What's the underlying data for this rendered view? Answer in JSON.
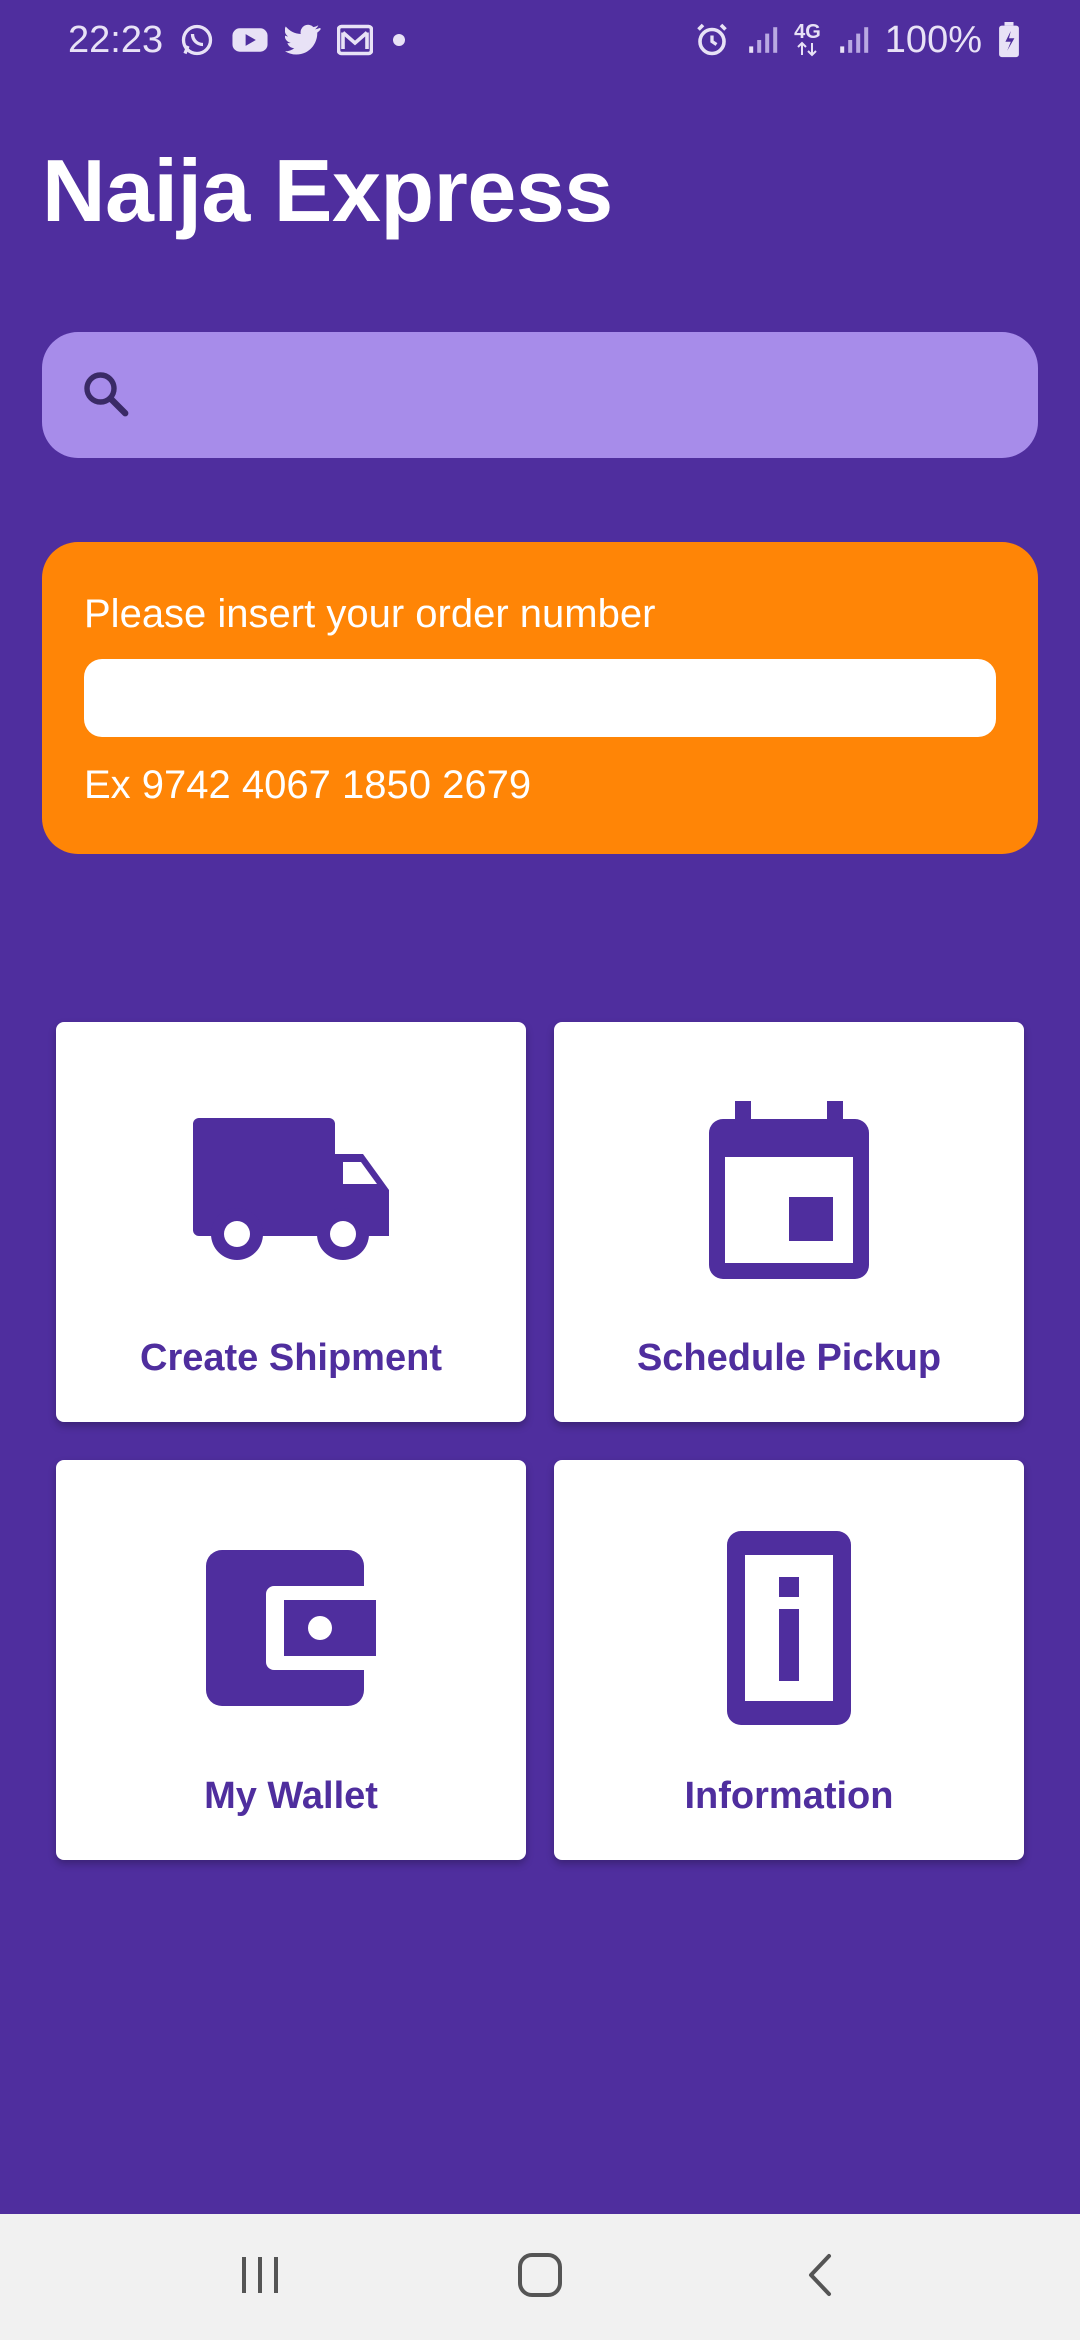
{
  "status_bar": {
    "time": "22:23",
    "notification_icons": [
      "whatsapp-icon",
      "youtube-icon",
      "twitter-icon",
      "gmail-icon",
      "dot-icon"
    ],
    "right_icons": [
      "alarm-icon",
      "signal-icon",
      "4g-icon",
      "signal-icon"
    ],
    "network_label": "4G",
    "battery": "100%"
  },
  "app": {
    "title": "Naija Express"
  },
  "search": {
    "placeholder": "",
    "value": ""
  },
  "order": {
    "label": "Please insert your order number",
    "value": "",
    "example": "Ex 9742 4067 1850 2679"
  },
  "tiles": [
    {
      "icon": "truck-icon",
      "label": "Create Shipment"
    },
    {
      "icon": "calendar-icon",
      "label": "Schedule Pickup"
    },
    {
      "icon": "wallet-icon",
      "label": "My Wallet"
    },
    {
      "icon": "info-icon",
      "label": "Information"
    }
  ],
  "nav": {
    "items": [
      "recents-button",
      "home-button",
      "back-button"
    ]
  },
  "colors": {
    "background": "#4f2e9e",
    "search_bg": "#a78cea",
    "order_card": "#ff8506",
    "tile_bg": "#ffffff",
    "tile_text": "#4f2e9e",
    "nav_bg": "#f1f1f1"
  }
}
